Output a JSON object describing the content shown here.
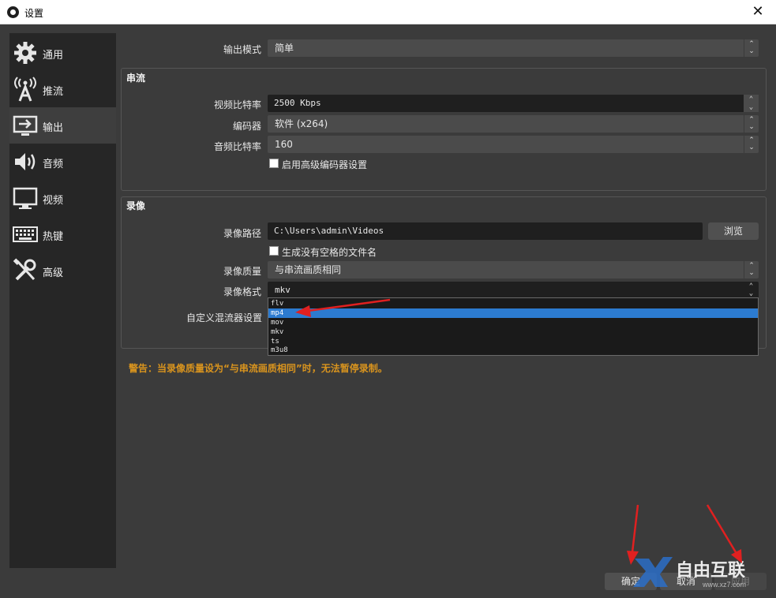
{
  "window": {
    "title": "设置",
    "close_glyph": "✕"
  },
  "sidebar": {
    "items": [
      {
        "label": "通用",
        "icon": "gear-icon"
      },
      {
        "label": "推流",
        "icon": "broadcast-tower-icon"
      },
      {
        "label": "输出",
        "icon": "output-monitor-icon"
      },
      {
        "label": "音频",
        "icon": "speaker-icon"
      },
      {
        "label": "视频",
        "icon": "monitor-icon"
      },
      {
        "label": "热键",
        "icon": "keyboard-icon"
      },
      {
        "label": "高级",
        "icon": "tools-icon"
      }
    ],
    "active_index": 2
  },
  "output_mode": {
    "label": "输出模式",
    "value": "简单"
  },
  "streaming": {
    "title": "串流",
    "video_bitrate": {
      "label": "视频比特率",
      "value": "2500 Kbps"
    },
    "encoder": {
      "label": "编码器",
      "value": "软件 (x264)"
    },
    "audio_bitrate": {
      "label": "音频比特率",
      "value": "160"
    },
    "advanced_encoder": {
      "label": "启用高级编码器设置",
      "checked": false
    }
  },
  "recording": {
    "title": "录像",
    "path": {
      "label": "录像路径",
      "value": "C:\\Users\\admin\\Videos",
      "browse_label": "浏览"
    },
    "no_space_filename": {
      "label": "生成没有空格的文件名",
      "checked": false
    },
    "quality": {
      "label": "录像质量",
      "value": "与串流画质相同"
    },
    "format": {
      "label": "录像格式",
      "value": "mkv",
      "options": [
        "flv",
        "mp4",
        "mov",
        "mkv",
        "ts",
        "m3u8"
      ],
      "highlighted": "mp4"
    },
    "muxer": {
      "label": "自定义混流器设置"
    }
  },
  "warning": "警告：当录像质量设为“与串流画质相同”时，无法暂停录制。",
  "footer": {
    "ok_label": "确定",
    "cancel_label": "取消",
    "apply_label": "应用"
  },
  "watermark": {
    "text": "自由互联",
    "sub": "www.xz7.com"
  },
  "colors": {
    "accent_highlight": "#2c7bd0",
    "warning": "#d9941e",
    "annotation_arrow": "#e02020",
    "background": "#3b3b3b",
    "sidebar": "#262626"
  }
}
